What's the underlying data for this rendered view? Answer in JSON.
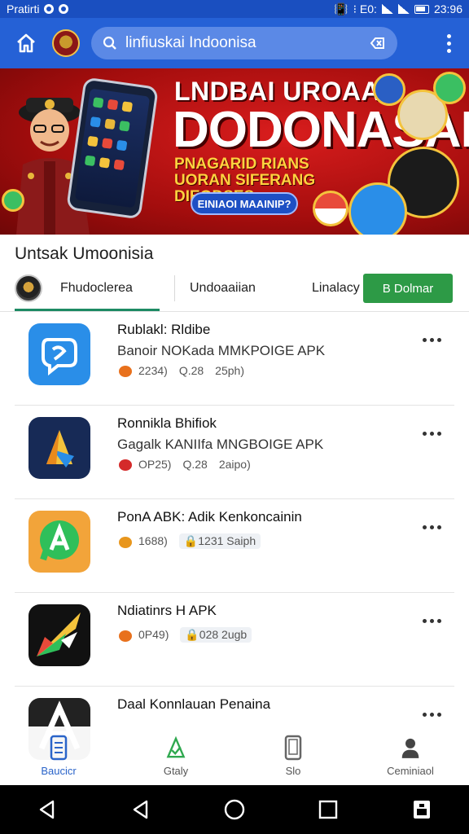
{
  "status_bar": {
    "left_text": "Pratirti",
    "right_text": "⁝ E0:",
    "time": "23:96"
  },
  "app_bar": {
    "search_text": "linfiuskai Indoonisa"
  },
  "banner": {
    "title_line1": "LNDBAI UROAAN",
    "title_line2": "DODONASAI",
    "subtitle": "PNAGARID RIANS UORAN SIFERANG DIEODSES",
    "cta": "EINIAOI MAAINIP?"
  },
  "section": {
    "title": "Untsak Umoonisia"
  },
  "tabs": {
    "tab1": "Fhudoclerea",
    "tab2": "Undoaaiian",
    "tab3": "Linalacy",
    "install": "B Dolmar"
  },
  "apps": [
    {
      "name": "Rublakl: Rldibe",
      "subtitle": "Banoir NOKada MMKPOIGE APK",
      "meta1": "2234)",
      "meta2": "Q.28",
      "meta3": "25ph)",
      "icon": "chat-bubble-icon",
      "icon_color": "#2a8ee8"
    },
    {
      "name": "Ronnikla Bhifiok",
      "subtitle": "Gagalk KANIIfa MNGBOIGE APK",
      "meta1": "OP25)",
      "meta2": "Q.28",
      "meta3": "2aipo)",
      "icon": "play-store-icon",
      "icon_color": "#172a56"
    },
    {
      "name": "PonA ABK: Adik Kenkoncainin",
      "subtitle": "",
      "meta1": "1688)",
      "meta2": "1231",
      "meta3": "Saiph",
      "icon": "whatsapp-a-icon",
      "icon_color": "#f2a43a"
    },
    {
      "name": "Ndiatinrs H APK",
      "subtitle": "",
      "meta1": "0P49)",
      "meta2": "028",
      "meta3": "2ugb",
      "icon": "color-swoosh-icon",
      "icon_color": "#111111"
    },
    {
      "name": "Daal Konnlauan Penaina",
      "subtitle": "",
      "meta1": "",
      "meta2": "",
      "meta3": "",
      "icon": "letter-a-icon",
      "icon_color": "#222222"
    }
  ],
  "bottom_nav": [
    {
      "label": "Baucicr",
      "icon": "phone-icon"
    },
    {
      "label": "Gtaly",
      "icon": "shield-check-icon"
    },
    {
      "label": "Slo",
      "icon": "device-icon"
    },
    {
      "label": "Ceminiaol",
      "icon": "person-icon"
    }
  ],
  "colors": {
    "status_bar": "#1a4fc0",
    "app_bar": "#2561d6",
    "install_button": "#2d9a46",
    "tab_underline": "#1d8a64",
    "nav_active": "#2a64c9"
  }
}
